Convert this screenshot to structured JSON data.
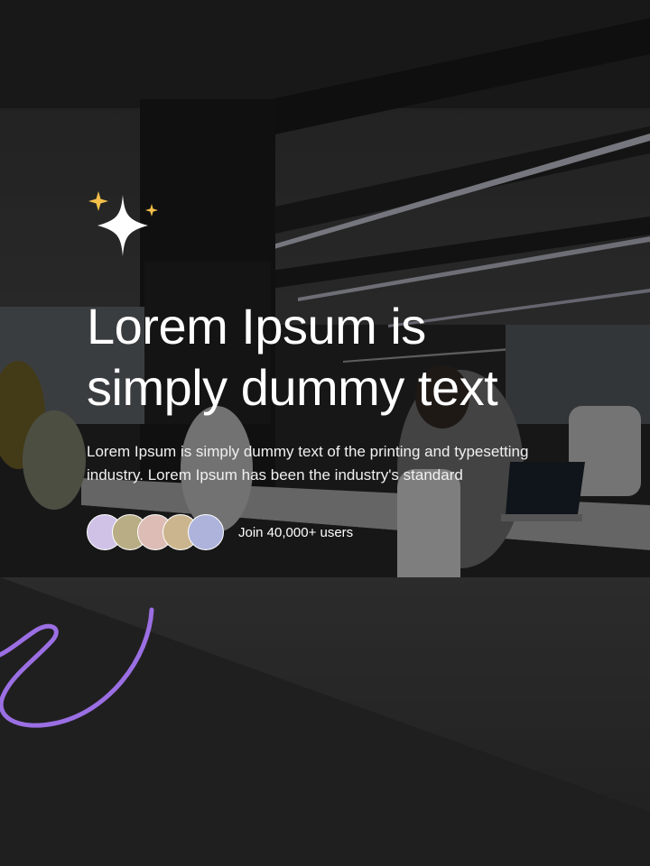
{
  "hero": {
    "headline_line1": "Lorem Ipsum is",
    "headline_line2": "simply dummy text",
    "subtext": "Lorem Ipsum is simply dummy text of the printing and typesetting industry. Lorem Ipsum has been the industry's standard",
    "users_label": "Join 40,000+ users"
  },
  "avatars": [
    {
      "name": "avatar-1",
      "color": "#cfc2e6"
    },
    {
      "name": "avatar-2",
      "color": "#b9ad85"
    },
    {
      "name": "avatar-3",
      "color": "#dcbcb4"
    },
    {
      "name": "avatar-4",
      "color": "#cbb58e"
    },
    {
      "name": "avatar-5",
      "color": "#aeb3dc"
    }
  ],
  "icons": {
    "sparkle": "sparkle-icon",
    "squiggle": "squiggle-decoration"
  },
  "colors": {
    "sparkle_small": "#f5c04a",
    "sparkle_large": "#ffffff",
    "squiggle": "#9b6fe3",
    "text": "#ffffff"
  }
}
